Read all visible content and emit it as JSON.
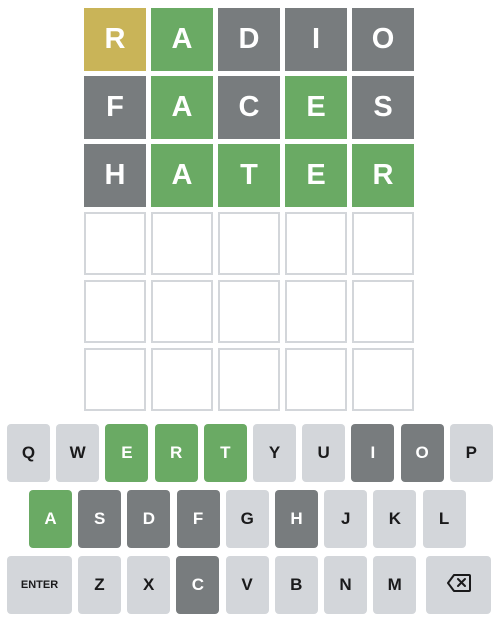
{
  "colors": {
    "correct": "#6aaa64",
    "present": "#c9b458",
    "absent": "#787c7e",
    "empty_border": "#d3d6da",
    "key_default": "#d3d6da"
  },
  "board": {
    "rows": [
      [
        {
          "letter": "R",
          "state": "present"
        },
        {
          "letter": "A",
          "state": "correct"
        },
        {
          "letter": "D",
          "state": "absent"
        },
        {
          "letter": "I",
          "state": "absent"
        },
        {
          "letter": "O",
          "state": "absent"
        }
      ],
      [
        {
          "letter": "F",
          "state": "absent"
        },
        {
          "letter": "A",
          "state": "correct"
        },
        {
          "letter": "C",
          "state": "absent"
        },
        {
          "letter": "E",
          "state": "correct"
        },
        {
          "letter": "S",
          "state": "absent"
        }
      ],
      [
        {
          "letter": "H",
          "state": "absent"
        },
        {
          "letter": "A",
          "state": "correct"
        },
        {
          "letter": "T",
          "state": "correct"
        },
        {
          "letter": "E",
          "state": "correct"
        },
        {
          "letter": "R",
          "state": "correct"
        }
      ],
      [
        {
          "letter": "",
          "state": "empty"
        },
        {
          "letter": "",
          "state": "empty"
        },
        {
          "letter": "",
          "state": "empty"
        },
        {
          "letter": "",
          "state": "empty"
        },
        {
          "letter": "",
          "state": "empty"
        }
      ],
      [
        {
          "letter": "",
          "state": "empty"
        },
        {
          "letter": "",
          "state": "empty"
        },
        {
          "letter": "",
          "state": "empty"
        },
        {
          "letter": "",
          "state": "empty"
        },
        {
          "letter": "",
          "state": "empty"
        }
      ],
      [
        {
          "letter": "",
          "state": "empty"
        },
        {
          "letter": "",
          "state": "empty"
        },
        {
          "letter": "",
          "state": "empty"
        },
        {
          "letter": "",
          "state": "empty"
        },
        {
          "letter": "",
          "state": "empty"
        }
      ]
    ]
  },
  "keyboard": {
    "rows": [
      [
        {
          "label": "Q",
          "state": "default"
        },
        {
          "label": "W",
          "state": "default"
        },
        {
          "label": "E",
          "state": "correct"
        },
        {
          "label": "R",
          "state": "correct"
        },
        {
          "label": "T",
          "state": "correct"
        },
        {
          "label": "Y",
          "state": "default"
        },
        {
          "label": "U",
          "state": "default"
        },
        {
          "label": "I",
          "state": "absent"
        },
        {
          "label": "O",
          "state": "absent"
        },
        {
          "label": "P",
          "state": "default"
        }
      ],
      [
        {
          "label": "A",
          "state": "correct"
        },
        {
          "label": "S",
          "state": "absent"
        },
        {
          "label": "D",
          "state": "absent"
        },
        {
          "label": "F",
          "state": "absent"
        },
        {
          "label": "G",
          "state": "default"
        },
        {
          "label": "H",
          "state": "absent"
        },
        {
          "label": "J",
          "state": "default"
        },
        {
          "label": "K",
          "state": "default"
        },
        {
          "label": "L",
          "state": "default"
        }
      ],
      [
        {
          "label": "ENTER",
          "state": "default",
          "kind": "enter"
        },
        {
          "label": "Z",
          "state": "default"
        },
        {
          "label": "X",
          "state": "default"
        },
        {
          "label": "C",
          "state": "absent"
        },
        {
          "label": "V",
          "state": "default"
        },
        {
          "label": "B",
          "state": "default"
        },
        {
          "label": "N",
          "state": "default"
        },
        {
          "label": "M",
          "state": "default"
        },
        {
          "label": "",
          "state": "default",
          "kind": "backspace",
          "icon": "backspace-icon"
        }
      ]
    ]
  }
}
